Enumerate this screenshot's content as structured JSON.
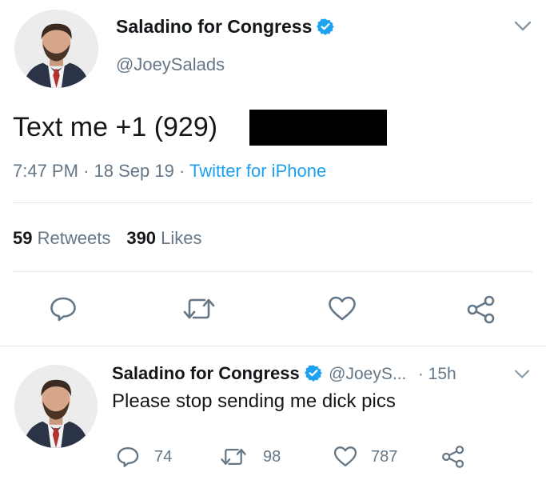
{
  "main_tweet": {
    "name": "Saladino for Congress",
    "handle": "@JoeySalads",
    "text": "Text me +1 (929)",
    "time": "7:47 PM",
    "date": "18 Sep 19",
    "source": "Twitter for iPhone",
    "separator": "·",
    "retweets_count": "59",
    "retweets_label": "Retweets",
    "likes_count": "390",
    "likes_label": "Likes"
  },
  "reply_tweet": {
    "name": "Saladino for Congress",
    "handle": "@JoeyS...",
    "age": "· 15h",
    "text": "Please stop sending me dick pics",
    "reply_count": "74",
    "retweet_count": "98",
    "like_count": "787"
  },
  "icons": {
    "verified": "verified-badge-icon",
    "chevron": "chevron-down-icon",
    "reply": "reply-icon",
    "retweet": "retweet-icon",
    "like": "heart-icon",
    "share": "share-icon"
  },
  "colors": {
    "accent": "#1da1f2",
    "text": "#14171a",
    "muted": "#657786",
    "divider": "#e1e8ed"
  }
}
